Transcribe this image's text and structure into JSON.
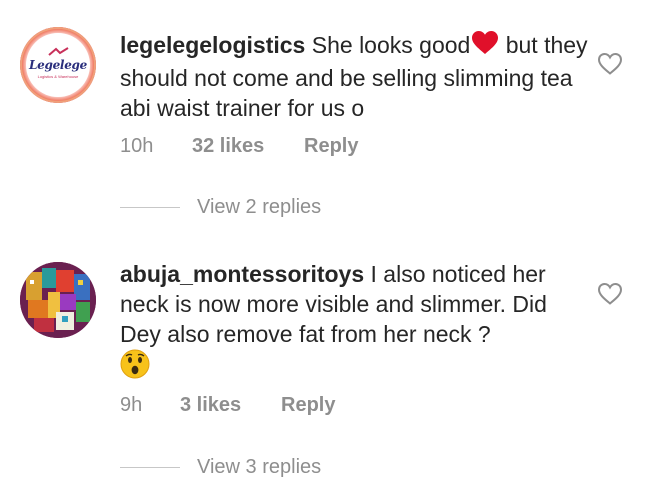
{
  "comments": [
    {
      "username": "legelegelogistics",
      "text_before_emoji": "She looks good",
      "emoji": "heart",
      "text_after_emoji": " but they should not come and be selling slimming tea abi waist trainer for us o",
      "avatar_logo_text": "Legelege",
      "avatar_logo_subtext": "Logistics & Warehouse",
      "time": "10h",
      "likes": "32 likes",
      "reply_label": "Reply",
      "view_replies": "View 2 replies"
    },
    {
      "username": "abuja_montessoritoys",
      "text": "I also noticed her neck is now more visible and slimmer. Did Dey also remove fat from her neck ?",
      "emoji": "astonished-face",
      "time": "9h",
      "likes": "3 likes",
      "reply_label": "Reply",
      "view_replies": "View 3 replies"
    }
  ],
  "colors": {
    "text": "#262626",
    "secondary": "#8e8e8e",
    "heart": "#e0102a",
    "divider": "#c7c7c7"
  },
  "icons": [
    "heart-outline-icon",
    "red-heart-emoji",
    "astonished-face-emoji"
  ]
}
